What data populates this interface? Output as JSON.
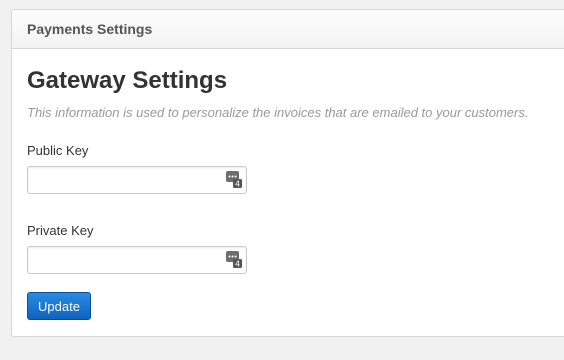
{
  "panel": {
    "title": "Payments Settings"
  },
  "gateway": {
    "heading": "Gateway Settings",
    "description": "This information is used to personalize the invoices that are emailed to your customers."
  },
  "fields": {
    "public_key": {
      "label": "Public Key",
      "value": "",
      "icon": "password-manager-icon"
    },
    "private_key": {
      "label": "Private Key",
      "value": "",
      "icon": "password-manager-icon"
    }
  },
  "actions": {
    "update_label": "Update"
  },
  "colors": {
    "accent": "#1a74d2",
    "background": "#f1f1f1"
  }
}
